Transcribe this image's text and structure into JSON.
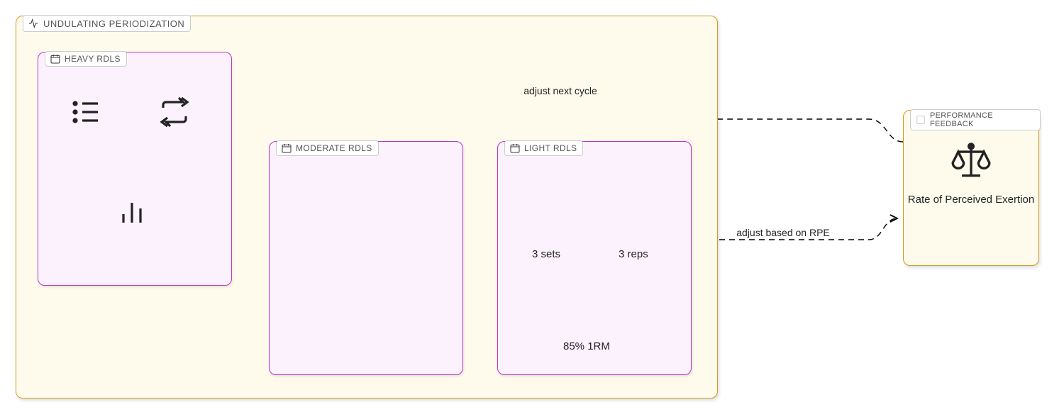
{
  "periodization": {
    "title": "UNDULATING PERIODIZATION",
    "sessions": {
      "heavy": {
        "title": "HEAVY RDLS"
      },
      "moderate": {
        "title": "MODERATE RDLS"
      },
      "light": {
        "title": "LIGHT RDLS",
        "sets": "3 sets",
        "reps": "3 reps",
        "load": "85% 1RM"
      }
    }
  },
  "feedback": {
    "title": "PERFORMANCE FEEDBACK",
    "label": "Rate of Perceived Exertion"
  },
  "edges": {
    "adjust_next_cycle": "adjust next cycle",
    "adjust_rpe": "adjust based on RPE"
  }
}
